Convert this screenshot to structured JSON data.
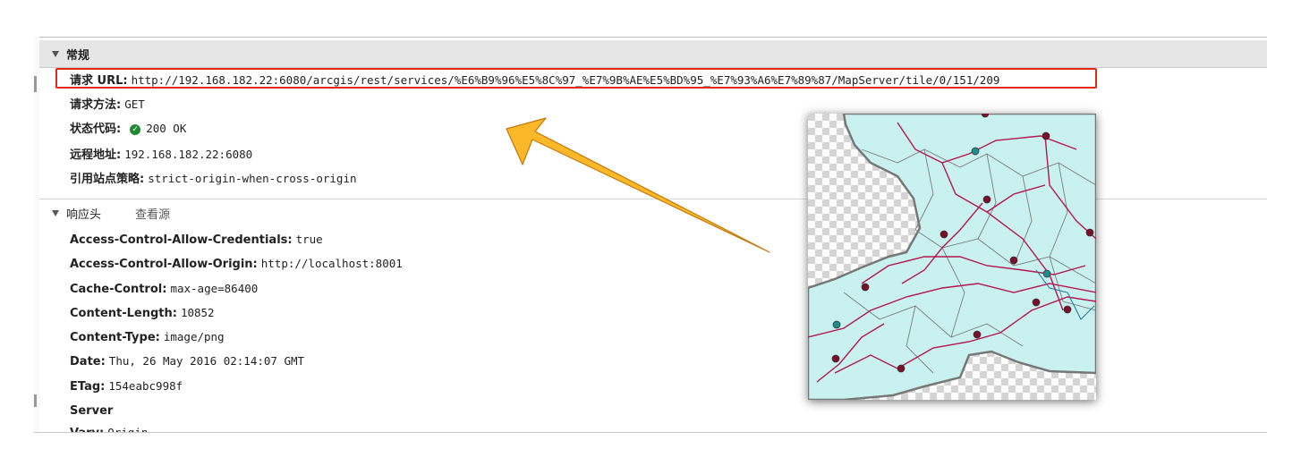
{
  "general": {
    "header": "常规",
    "rows": [
      {
        "key": "请求 URL:",
        "value": "http://192.168.182.22:6080/arcgis/rest/services/%E6%B9%96%E5%8C%97_%E7%9B%AE%E5%BD%95_%E7%93%A6%E7%89%87/MapServer/tile/0/151/209"
      },
      {
        "key": "请求方法:",
        "value": "GET"
      },
      {
        "key": "状态代码:",
        "value": "200 OK"
      },
      {
        "key": "远程地址:",
        "value": "192.168.182.22:6080"
      },
      {
        "key": "引用站点策略:",
        "value": "strict-origin-when-cross-origin"
      }
    ]
  },
  "response_headers": {
    "header": "响应头",
    "view_source": "查看源",
    "rows": [
      {
        "key": "Access-Control-Allow-Credentials:",
        "value": "true"
      },
      {
        "key": "Access-Control-Allow-Origin:",
        "value": "http://localhost:8001"
      },
      {
        "key": "Cache-Control:",
        "value": "max-age=86400"
      },
      {
        "key": "Content-Length:",
        "value": "10852"
      },
      {
        "key": "Content-Type:",
        "value": "image/png"
      },
      {
        "key": "Date:",
        "value": "Thu, 26 May 2016 02:14:07 GMT"
      },
      {
        "key": "ETag:",
        "value": "154eabc998f"
      },
      {
        "key": "Server",
        "value": ""
      },
      {
        "key": "Vary:",
        "value": "Origin"
      }
    ]
  },
  "colors": {
    "highlight_box": "#e02a1a",
    "arrow_fill": "#fbb829",
    "map_land": "#c8f1ef",
    "map_roads": "#b5164f",
    "status_ok": "#1e8a2e"
  },
  "icons": {
    "status": "check-circle-icon",
    "collapse": "triangle-down-icon"
  }
}
